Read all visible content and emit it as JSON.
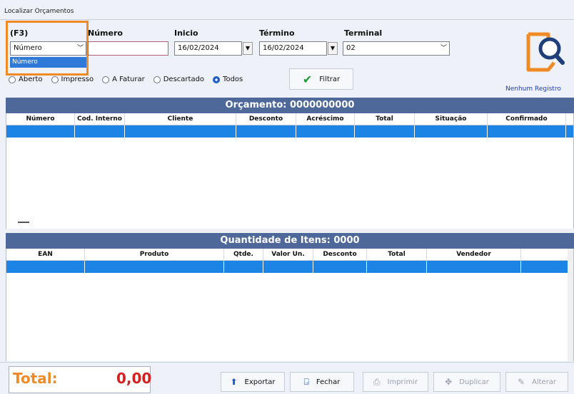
{
  "window": {
    "title": "Localizar Orçamentos"
  },
  "filters": {
    "f3_label": "(F3)",
    "search_type_value": "Número",
    "search_type_option": "Número",
    "numero_label": "Número",
    "numero_value": "",
    "inicio_label": "Inicio",
    "inicio_value": "16/02/2024",
    "termino_label": "Término",
    "termino_value": "16/02/2024",
    "terminal_label": "Terminal",
    "terminal_value": "02"
  },
  "status_radios": [
    {
      "label": "Aberto",
      "checked": false
    },
    {
      "label": "Impresso",
      "checked": false
    },
    {
      "label": "A Faturar",
      "checked": false
    },
    {
      "label": "Descartado",
      "checked": false
    },
    {
      "label": "Todos",
      "checked": true
    }
  ],
  "filter_button": {
    "label": "Filtrar"
  },
  "no_records_label": "Nenhum Registro",
  "orcamento_header": "Orçamento: 0000000000",
  "orcamento_columns": [
    "Número",
    "Cod. Interno",
    "Cliente",
    "Desconto",
    "Acréscimo",
    "Total",
    "Situação",
    "Confirmado"
  ],
  "itens_header": "Quantidade de Itens: 0000",
  "itens_columns": [
    "EAN",
    "Produto",
    "Qtde.",
    "Valor Un.",
    "Desconto",
    "Total",
    "Vendedor"
  ],
  "total": {
    "label": "Total:",
    "value": "0,00"
  },
  "buttons": {
    "exportar": "Exportar",
    "fechar": "Fechar",
    "imprimir": "Imprimir",
    "duplicar": "Duplicar",
    "alterar": "Alterar"
  },
  "colors": {
    "accent": "#f08a24",
    "header_band": "#4e6999",
    "selected_row": "#1c84e4",
    "total_value": "#d42020"
  }
}
